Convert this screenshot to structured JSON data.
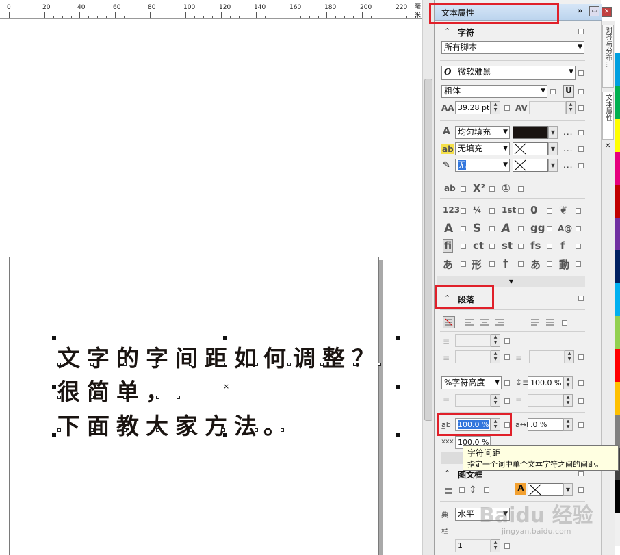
{
  "ruler": {
    "labels": [
      "0",
      "20",
      "40",
      "60",
      "80",
      "100",
      "120",
      "140",
      "160",
      "180",
      "200",
      "220"
    ],
    "unit": "毫米"
  },
  "canvas": {
    "art_lines": [
      "文字的字间距如何调整？",
      "很简单，",
      "下面教大家方法。"
    ]
  },
  "panel": {
    "title": "文本属性",
    "expand_icon": "»",
    "minimize_icon": "▭",
    "close_icon": "✕",
    "character": {
      "heading": "字符",
      "script": "所有脚本",
      "font_icon": "O",
      "font": "微软雅黑",
      "style": "粗体",
      "underline_icon": "U",
      "size_icon": "AA",
      "size": "39.28 pt",
      "kerning_icon": "AV",
      "fill_icon": "A",
      "fill_type": "均匀填充",
      "bg_icon": "ab",
      "bg_fill": "无填充",
      "outline_icon": "pen",
      "outline": "无",
      "more": "...",
      "glyph_row1": [
        "ab",
        "X²",
        "①"
      ],
      "glyph_rows": [
        [
          "123",
          "¼",
          "1st",
          "0",
          "❦"
        ],
        [
          "A",
          "S",
          "A",
          "gg",
          "A@"
        ],
        [
          "fi",
          "ct",
          "st",
          "fs",
          "f"
        ],
        [
          "あ",
          "形",
          "†",
          "あ",
          "動"
        ]
      ],
      "expand_arrow": "▼"
    },
    "paragraph": {
      "heading": "段落",
      "align_icons": [
        "align-none",
        "align-left",
        "align-center",
        "align-right",
        "justify",
        "force-justify"
      ],
      "line_spacing_unit": "%字符高度",
      "line_spacing": "100.0 %",
      "char_spacing": "100.0 %",
      "word_spacing": ".0 %",
      "lang_spacing": "100.0 %"
    },
    "frame": {
      "heading": "图文框",
      "direction_label": "典",
      "direction": "水平",
      "columns_label": "栏",
      "columns": "1"
    }
  },
  "tabs": {
    "tab1": "对齐与分布...",
    "tab2": "文本属性",
    "tab_close": "✕"
  },
  "tooltip": {
    "title": "字符间距",
    "body": "指定一个词中单个文本字符之间的间距。"
  },
  "watermark": {
    "logo": "Baidu 经验",
    "sub": "jingyan.baidu.com"
  },
  "colors": {
    "title_bar": "#c9ddf2",
    "highlight": "#e0202a",
    "fill_color": "#1a1411",
    "palette": [
      "#ffffff",
      "#00a0e0",
      "#00b050",
      "#ffff00",
      "#e6007e",
      "#c00000",
      "#7030a0",
      "#002060",
      "#00b0f0",
      "#92d050",
      "#ff0000",
      "#ffc000",
      "#808080",
      "#404040",
      "#000000",
      "#f0f0f0"
    ]
  }
}
